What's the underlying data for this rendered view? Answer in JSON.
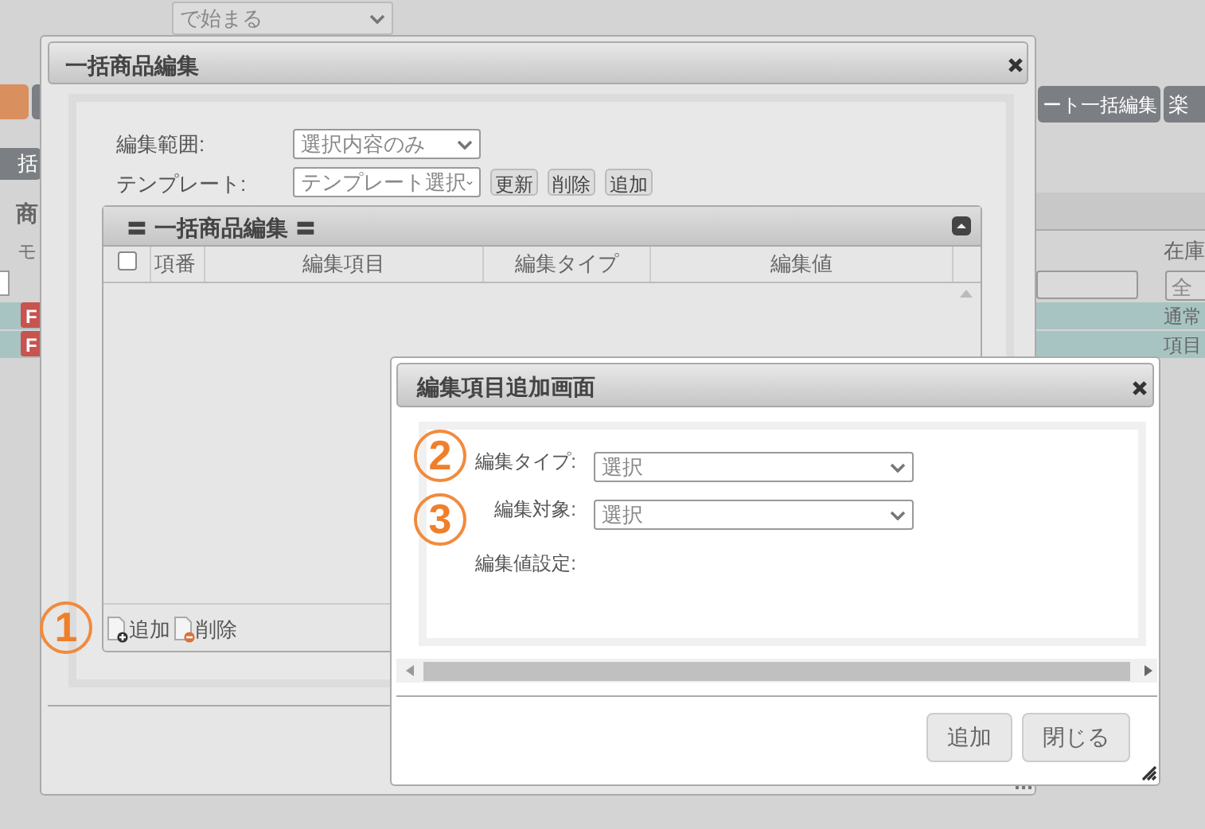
{
  "background": {
    "filter_select": "で始まる",
    "left_buttons": [
      {
        "kind": "orange"
      },
      {
        "label": "括",
        "kind": "dark"
      }
    ],
    "section_title": "商",
    "column_header": "モ",
    "row_badges": [
      "F",
      "F"
    ],
    "right_button": "ート一括編集",
    "right_button_cut": "楽",
    "stock_header": "在庫",
    "stock_filter": "全",
    "stock_rows": [
      "通常",
      "項目"
    ]
  },
  "main_dialog": {
    "title": "一括商品編集",
    "scope_label": "編集範囲:",
    "scope_value": "選択内容のみ",
    "template_label": "テンプレート:",
    "template_value": "テンプレート選択",
    "template_buttons": [
      "更新",
      "削除",
      "追加"
    ],
    "grid": {
      "title": "〓 一括商品編集 〓",
      "header_checkbox": {
        "checked": false
      },
      "columns": [
        "項番",
        "編集項目",
        "編集タイプ",
        "編集値"
      ]
    },
    "toolbar": [
      {
        "label": "追加",
        "kind": "add"
      },
      {
        "label": "削除",
        "kind": "delete"
      }
    ]
  },
  "add_dialog": {
    "title": "編集項目追加画面",
    "fields": [
      {
        "label": "編集タイプ:",
        "value": "選択",
        "kind": "select"
      },
      {
        "label": "編集対象:",
        "value": "選択",
        "kind": "select"
      },
      {
        "label": "編集値設定:",
        "kind": "text"
      }
    ],
    "buttons": [
      "追加",
      "閉じる"
    ]
  },
  "markers": [
    "1",
    "2",
    "3"
  ]
}
